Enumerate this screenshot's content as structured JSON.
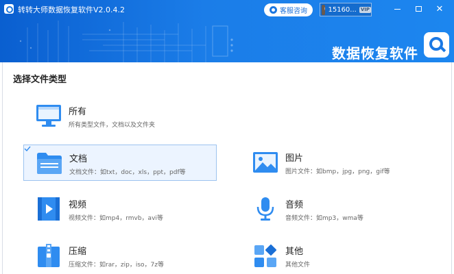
{
  "window": {
    "title": "转转大师数据恢复软件V2.0.4.2",
    "service_label": "客服咨询",
    "user_phone": "15160...",
    "vip_label": "VIP",
    "minimize_glyph": "—",
    "restore_glyph": "□",
    "close_glyph": "✕"
  },
  "brand": {
    "name": "数据恢复软件"
  },
  "section": {
    "title": "选择文件类型"
  },
  "file_types": [
    {
      "name": "所有",
      "desc": "所有类型文件，文档以及文件夹",
      "icon": "monitor-icon",
      "selected": false
    },
    {
      "name": "文档",
      "desc": "文档文件：如txt，doc，xls，ppt，pdf等",
      "icon": "folder-icon",
      "selected": true
    },
    {
      "name": "图片",
      "desc": "图片文件：如bmp，jpg，png，gif等",
      "icon": "image-icon",
      "selected": false
    },
    {
      "name": "视频",
      "desc": "视频文件：如mp4，rmvb，avi等",
      "icon": "video-icon",
      "selected": false
    },
    {
      "name": "音频",
      "desc": "音频文件：如mp3，wma等",
      "icon": "microphone-icon",
      "selected": false
    },
    {
      "name": "压缩",
      "desc": "压缩文件：如rar，zip，iso，7z等",
      "icon": "archive-icon",
      "selected": false
    },
    {
      "name": "其他",
      "desc": "其他文件",
      "icon": "other-icon",
      "selected": false
    }
  ],
  "colors": {
    "header_blue": "#1b7de8",
    "icon_blue": "#2f8cf0",
    "selected_bg": "#ecf4ff",
    "selected_border": "#9cc3ef"
  }
}
